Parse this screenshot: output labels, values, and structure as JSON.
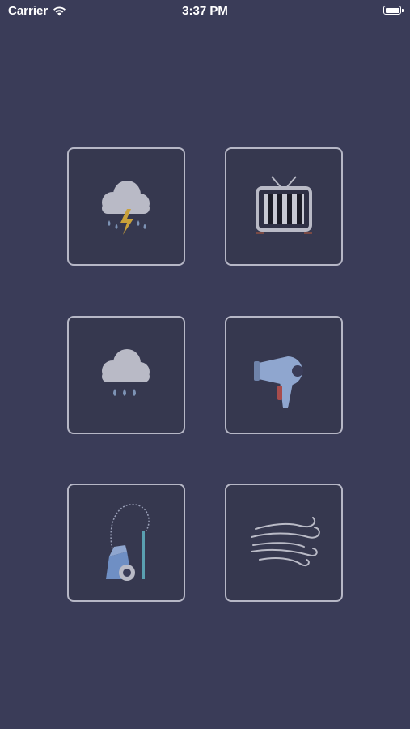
{
  "status_bar": {
    "carrier": "Carrier",
    "time": "3:37 PM"
  },
  "sound_tiles": [
    {
      "name": "thunderstorm",
      "icon": "storm-cloud-icon"
    },
    {
      "name": "tv-static",
      "icon": "tv-icon"
    },
    {
      "name": "rain",
      "icon": "rain-cloud-icon"
    },
    {
      "name": "hair-dryer",
      "icon": "hair-dryer-icon"
    },
    {
      "name": "vacuum-cleaner",
      "icon": "vacuum-cleaner-icon"
    },
    {
      "name": "wind",
      "icon": "wind-icon"
    }
  ],
  "colors": {
    "background": "#3a3c58",
    "tile_border": "#b6b7c6",
    "cloud": "#b9bac6",
    "rain_drop": "#7d93b5",
    "lightning": "#c9a13a"
  }
}
